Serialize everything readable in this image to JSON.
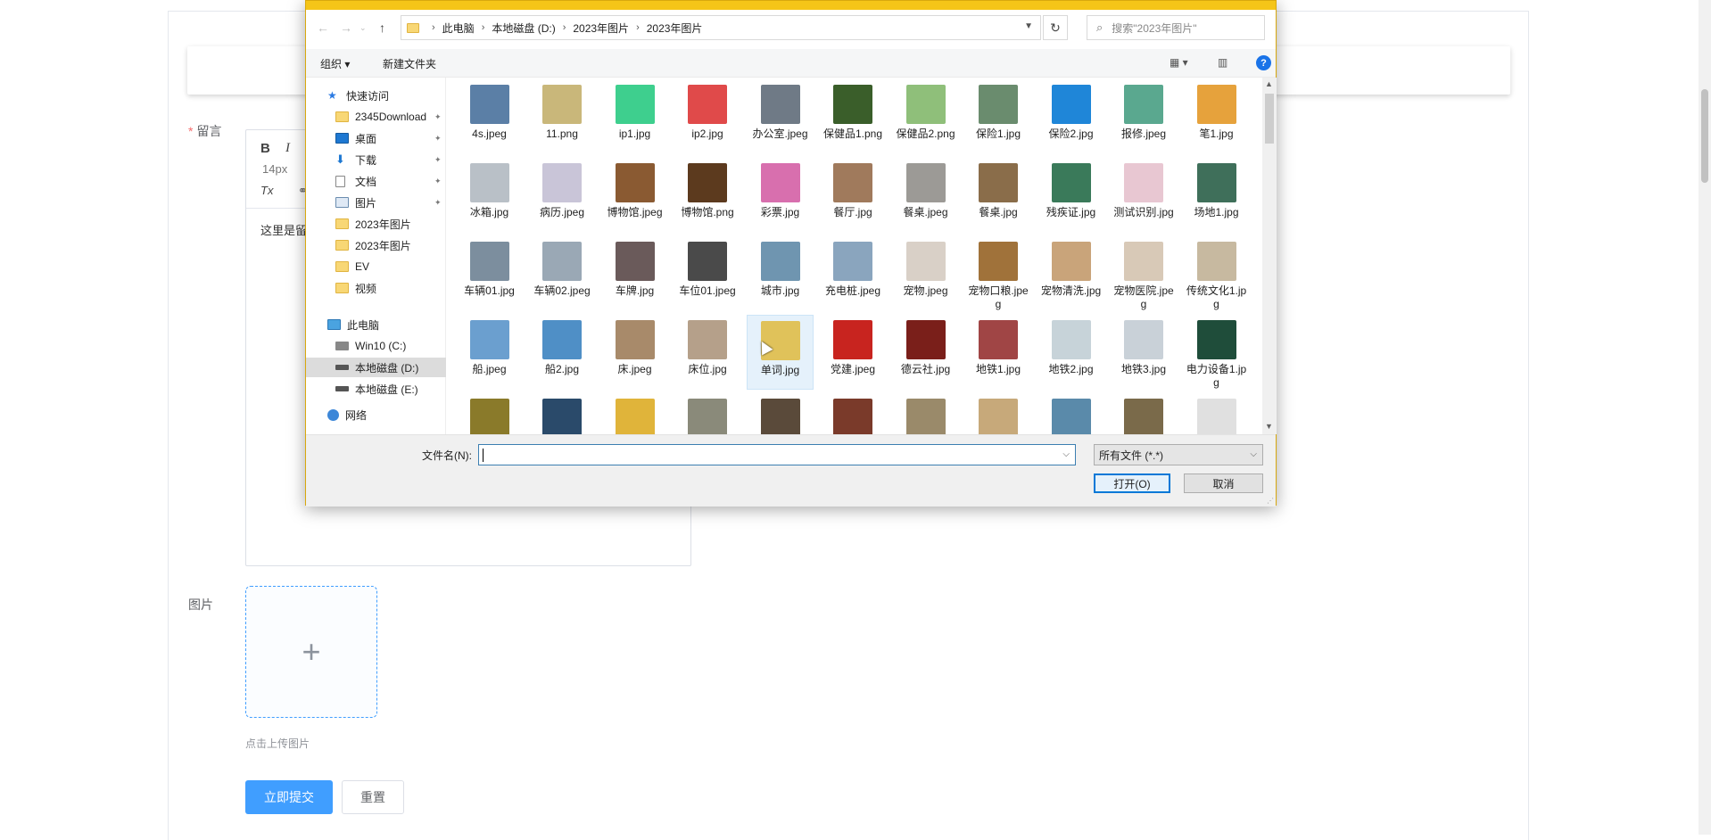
{
  "page": {
    "message_label": "留言",
    "editor": {
      "bold": "B",
      "italic": "I",
      "font_size": "14px",
      "clear_format": "Tx",
      "content": "这里是留"
    },
    "image_label": "图片",
    "upload_plus": "+",
    "upload_tip": "点击上传图片",
    "submit_label": "立即提交",
    "reset_label": "重置"
  },
  "dialog": {
    "breadcrumb": [
      "此电脑",
      "本地磁盘 (D:)",
      "2023年图片",
      "2023年图片"
    ],
    "search_placeholder": "搜索\"2023年图片\"",
    "toolbar": {
      "organize": "组织 ▾",
      "new_folder": "新建文件夹",
      "help": "?"
    },
    "nav": {
      "quick_access": "快速访问",
      "items": [
        {
          "label": "2345Download",
          "icon": "folder-icon",
          "pinned": true
        },
        {
          "label": "桌面",
          "icon": "desktop-icon",
          "pinned": true
        },
        {
          "label": "下载",
          "icon": "download-icon",
          "pinned": true
        },
        {
          "label": "文档",
          "icon": "document-icon",
          "pinned": true
        },
        {
          "label": "图片",
          "icon": "pictures-icon",
          "pinned": true
        },
        {
          "label": "2023年图片",
          "icon": "folder-icon",
          "pinned": false
        },
        {
          "label": "2023年图片",
          "icon": "folder-icon",
          "pinned": false
        },
        {
          "label": "EV",
          "icon": "folder-icon",
          "pinned": false
        },
        {
          "label": "视频",
          "icon": "folder-icon",
          "pinned": false
        }
      ],
      "this_pc": "此电脑",
      "drives": [
        {
          "label": "Win10 (C:)",
          "icon": "windows-drive-icon",
          "selected": false
        },
        {
          "label": "本地磁盘 (D:)",
          "icon": "drive-icon",
          "selected": true
        },
        {
          "label": "本地磁盘 (E:)",
          "icon": "drive-icon",
          "selected": false
        }
      ],
      "network": "网络"
    },
    "files": [
      {
        "name": "4s.jpeg",
        "color": "#5b7fa6"
      },
      {
        "name": "11.png",
        "color": "#c9b77a"
      },
      {
        "name": "ip1.jpg",
        "color": "#3ecf8e"
      },
      {
        "name": "ip2.jpg",
        "color": "#e04a4a"
      },
      {
        "name": "办公室.jpeg",
        "color": "#6f7a86"
      },
      {
        "name": "保健品1.png",
        "color": "#3a5e2a"
      },
      {
        "name": "保健品2.png",
        "color": "#8fbf7a"
      },
      {
        "name": "保险1.jpg",
        "color": "#6a8c6e"
      },
      {
        "name": "保险2.jpg",
        "color": "#1f86d8"
      },
      {
        "name": "报修.jpeg",
        "color": "#5aa88f"
      },
      {
        "name": "笔1.jpg",
        "color": "#e6a23c"
      },
      {
        "name": "冰箱.jpg",
        "color": "#b9c0c7"
      },
      {
        "name": "病历.jpeg",
        "color": "#c9c5d8"
      },
      {
        "name": "博物馆.jpeg",
        "color": "#8a5a32"
      },
      {
        "name": "博物馆.png",
        "color": "#5c3a1e"
      },
      {
        "name": "彩票.jpg",
        "color": "#d86fae"
      },
      {
        "name": "餐厅.jpg",
        "color": "#a07a5c"
      },
      {
        "name": "餐桌.jpeg",
        "color": "#9c9a96"
      },
      {
        "name": "餐桌.jpg",
        "color": "#8a6d4a"
      },
      {
        "name": "残疾证.jpg",
        "color": "#3a7a5a"
      },
      {
        "name": "测试识别.jpg",
        "color": "#e8c7d2"
      },
      {
        "name": "场地1.jpg",
        "color": "#3f6f5a"
      },
      {
        "name": "车辆01.jpg",
        "color": "#7c8e9e"
      },
      {
        "name": "车辆02.jpeg",
        "color": "#9aa8b5"
      },
      {
        "name": "车牌.jpg",
        "color": "#6a5a5a"
      },
      {
        "name": "车位01.jpeg",
        "color": "#4a4a4a"
      },
      {
        "name": "城市.jpg",
        "color": "#6f95b0"
      },
      {
        "name": "充电桩.jpeg",
        "color": "#8aa5be"
      },
      {
        "name": "宠物.jpeg",
        "color": "#d9d0c7"
      },
      {
        "name": "宠物口粮.jpeg",
        "color": "#a0723a"
      },
      {
        "name": "宠物清洗.jpg",
        "color": "#c9a47a"
      },
      {
        "name": "宠物医院.jpeg",
        "color": "#d8c9b7"
      },
      {
        "name": "传统文化1.jpg",
        "color": "#c7b9a0"
      },
      {
        "name": "船.jpeg",
        "color": "#6b9fcf"
      },
      {
        "name": "船2.jpg",
        "color": "#4f8fc6"
      },
      {
        "name": "床.jpeg",
        "color": "#a88a6a"
      },
      {
        "name": "床位.jpg",
        "color": "#b5a08a"
      },
      {
        "name": "单词.jpg",
        "color": "#e0c25a"
      },
      {
        "name": "党建.jpeg",
        "color": "#c8241f"
      },
      {
        "name": "德云社.jpg",
        "color": "#7a1f1a"
      },
      {
        "name": "地铁1.jpg",
        "color": "#a04545"
      },
      {
        "name": "地铁2.jpg",
        "color": "#c7d3d9"
      },
      {
        "name": "地铁3.jpg",
        "color": "#c9d1d8"
      },
      {
        "name": "电力设备1.jpg",
        "color": "#1f4d3a"
      },
      {
        "name": "",
        "color": "#8a7a2a"
      },
      {
        "name": "",
        "color": "#2a4a6a"
      },
      {
        "name": "",
        "color": "#e0b43a"
      },
      {
        "name": "",
        "color": "#8a8a7a"
      },
      {
        "name": "",
        "color": "#5a4a3a"
      },
      {
        "name": "",
        "color": "#7a3a2a"
      },
      {
        "name": "",
        "color": "#9a8a6a"
      },
      {
        "name": "",
        "color": "#c7a97a"
      },
      {
        "name": "",
        "color": "#5a8aaa"
      },
      {
        "name": "",
        "color": "#7a6a4a"
      },
      {
        "name": "",
        "color": "#e0e0e0"
      }
    ],
    "footer": {
      "filename_label": "文件名(N):",
      "filename_value": "",
      "filter_value": "所有文件 (*.*)",
      "open_label": "打开(O)",
      "cancel_label": "取消"
    }
  }
}
